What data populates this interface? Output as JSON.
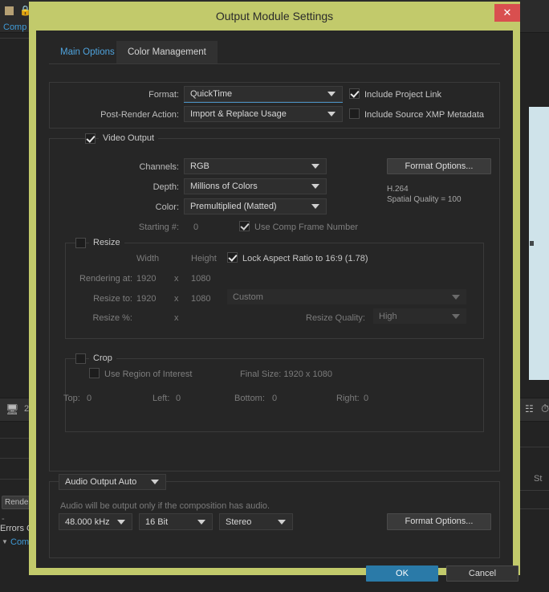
{
  "background": {
    "comp_tab": "Comp",
    "lock_icon": "lock-icon",
    "square_icon": "square-icon",
    "left_toolbar_number": "2",
    "monitor_icon": "monitor-icon",
    "render_button": "Render ",
    "dash": "-",
    "errors_label": "Errors C",
    "comp_link": "Comp",
    "right_st": "St",
    "network_icon": "network-icon",
    "clock_icon": "clock-icon"
  },
  "dialog": {
    "title": "Output Module Settings",
    "close_label": "✕",
    "tabs": [
      {
        "label": "Main Options",
        "active": true
      },
      {
        "label": "Color Management",
        "active": false
      }
    ],
    "format_section": {
      "format_label": "Format:",
      "format_value": "QuickTime",
      "post_render_label": "Post-Render Action:",
      "post_render_value": "Import & Replace Usage",
      "include_project_link": "Include Project Link",
      "include_project_link_checked": true,
      "include_xmp": "Include Source XMP Metadata",
      "include_xmp_checked": false
    },
    "video_output": {
      "group_label": "Video Output",
      "group_checked": true,
      "channels_label": "Channels:",
      "channels_value": "RGB",
      "depth_label": "Depth:",
      "depth_value": "Millions of Colors",
      "color_label": "Color:",
      "color_value": "Premultiplied (Matted)",
      "starting_label": "Starting #:",
      "starting_value": "0",
      "use_comp_frame_number": "Use Comp Frame Number",
      "use_comp_frame_number_checked": true,
      "format_options_button": "Format Options...",
      "codec_info_line1": "H.264",
      "codec_info_line2": "Spatial Quality = 100"
    },
    "resize": {
      "group_label": "Resize",
      "group_checked": false,
      "width_header": "Width",
      "height_header": "Height",
      "lock_aspect_label": "Lock Aspect Ratio to  16:9 (1.78)",
      "lock_aspect_checked": true,
      "rendering_at_label": "Rendering at:",
      "rendering_width": "1920",
      "rendering_x": "x",
      "rendering_height": "1080",
      "resize_to_label": "Resize to:",
      "resize_width": "1920",
      "resize_x": "x",
      "resize_height": "1080",
      "preset_value": "Custom",
      "resize_pct_label": "Resize %:",
      "resize_pct_x": "x",
      "resize_quality_label": "Resize Quality:",
      "resize_quality_value": "High"
    },
    "crop": {
      "group_label": "Crop",
      "group_checked": false,
      "use_region_label": "Use Region of Interest",
      "use_region_checked": false,
      "final_size": "Final Size: 1920 x 1080",
      "top_label": "Top:",
      "top_value": "0",
      "left_label": "Left:",
      "left_value": "0",
      "bottom_label": "Bottom:",
      "bottom_value": "0",
      "right_label": "Right:",
      "right_value": "0"
    },
    "audio": {
      "group_label": "Audio Output Auto",
      "note": "Audio will be output only if the composition has audio.",
      "sample_rate": "48.000 kHz",
      "bit_depth": "16 Bit",
      "channels": "Stereo",
      "format_options_button": "Format Options..."
    },
    "footer": {
      "ok": "OK",
      "cancel": "Cancel"
    }
  }
}
